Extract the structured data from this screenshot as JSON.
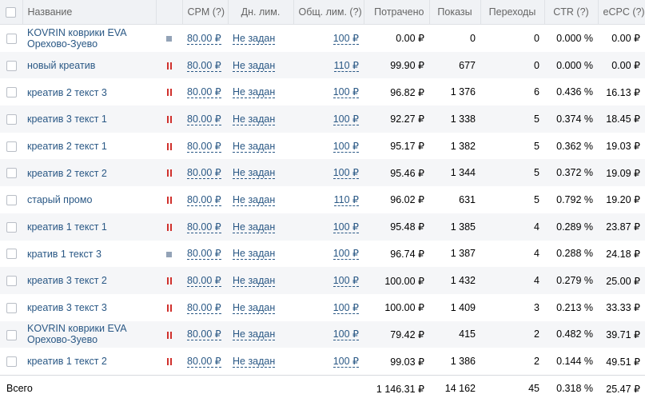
{
  "header": {
    "name": "Название",
    "cpm": "CPM (?)",
    "daily_limit": "Дн. лим.",
    "total_limit": "Общ. лим. (?)",
    "spent": "Потрачено",
    "shows": "Показы",
    "transitions": "Переходы",
    "ctr": "CTR (?)",
    "ecpc": "eCPC (?)"
  },
  "rows": [
    {
      "name": "KOVRIN коврики EVA Орехово-Зуево",
      "status": "stopped",
      "cpm": "80.00 ₽",
      "daily_limit": "Не задан",
      "total_limit": "100 ₽",
      "spent": "0.00 ₽",
      "shows": "0",
      "transitions": "0",
      "ctr": "0.000 %",
      "ecpc": "0.00 ₽"
    },
    {
      "name": "новый креатив",
      "status": "paused",
      "cpm": "80.00 ₽",
      "daily_limit": "Не задан",
      "total_limit": "110 ₽",
      "spent": "99.90 ₽",
      "shows": "677",
      "transitions": "0",
      "ctr": "0.000 %",
      "ecpc": "0.00 ₽"
    },
    {
      "name": "креатив 2 текст 3",
      "status": "paused",
      "cpm": "80.00 ₽",
      "daily_limit": "Не задан",
      "total_limit": "100 ₽",
      "spent": "96.82 ₽",
      "shows": "1 376",
      "transitions": "6",
      "ctr": "0.436 %",
      "ecpc": "16.13 ₽"
    },
    {
      "name": "креатив 3 текст 1",
      "status": "paused",
      "cpm": "80.00 ₽",
      "daily_limit": "Не задан",
      "total_limit": "100 ₽",
      "spent": "92.27 ₽",
      "shows": "1 338",
      "transitions": "5",
      "ctr": "0.374 %",
      "ecpc": "18.45 ₽"
    },
    {
      "name": "креатив 2 текст 1",
      "status": "paused",
      "cpm": "80.00 ₽",
      "daily_limit": "Не задан",
      "total_limit": "100 ₽",
      "spent": "95.17 ₽",
      "shows": "1 382",
      "transitions": "5",
      "ctr": "0.362 %",
      "ecpc": "19.03 ₽"
    },
    {
      "name": "креатив 2 текст 2",
      "status": "paused",
      "cpm": "80.00 ₽",
      "daily_limit": "Не задан",
      "total_limit": "100 ₽",
      "spent": "95.46 ₽",
      "shows": "1 344",
      "transitions": "5",
      "ctr": "0.372 %",
      "ecpc": "19.09 ₽"
    },
    {
      "name": "старый промо",
      "status": "paused",
      "cpm": "80.00 ₽",
      "daily_limit": "Не задан",
      "total_limit": "110 ₽",
      "spent": "96.02 ₽",
      "shows": "631",
      "transitions": "5",
      "ctr": "0.792 %",
      "ecpc": "19.20 ₽"
    },
    {
      "name": "креатив 1 текст 1",
      "status": "paused",
      "cpm": "80.00 ₽",
      "daily_limit": "Не задан",
      "total_limit": "100 ₽",
      "spent": "95.48 ₽",
      "shows": "1 385",
      "transitions": "4",
      "ctr": "0.289 %",
      "ecpc": "23.87 ₽"
    },
    {
      "name": "кратив 1 текст 3",
      "status": "stopped",
      "cpm": "80.00 ₽",
      "daily_limit": "Не задан",
      "total_limit": "100 ₽",
      "spent": "96.74 ₽",
      "shows": "1 387",
      "transitions": "4",
      "ctr": "0.288 %",
      "ecpc": "24.18 ₽"
    },
    {
      "name": "креатив 3 текст 2",
      "status": "paused",
      "cpm": "80.00 ₽",
      "daily_limit": "Не задан",
      "total_limit": "100 ₽",
      "spent": "100.00 ₽",
      "shows": "1 432",
      "transitions": "4",
      "ctr": "0.279 %",
      "ecpc": "25.00 ₽"
    },
    {
      "name": "креатив 3 текст 3",
      "status": "paused",
      "cpm": "80.00 ₽",
      "daily_limit": "Не задан",
      "total_limit": "100 ₽",
      "spent": "100.00 ₽",
      "shows": "1 409",
      "transitions": "3",
      "ctr": "0.213 %",
      "ecpc": "33.33 ₽"
    },
    {
      "name": "KOVRIN коврики EVA Орехово-Зуево",
      "status": "paused",
      "cpm": "80.00 ₽",
      "daily_limit": "Не задан",
      "total_limit": "100 ₽",
      "spent": "79.42 ₽",
      "shows": "415",
      "transitions": "2",
      "ctr": "0.482 %",
      "ecpc": "39.71 ₽"
    },
    {
      "name": "креатив 1 текст 2",
      "status": "paused",
      "cpm": "80.00 ₽",
      "daily_limit": "Не задан",
      "total_limit": "100 ₽",
      "spent": "99.03 ₽",
      "shows": "1 386",
      "transitions": "2",
      "ctr": "0.144 %",
      "ecpc": "49.51 ₽"
    }
  ],
  "totals": {
    "label": "Всего",
    "spent": "1 146.31 ₽",
    "shows": "14 162",
    "transitions": "45",
    "ctr": "0.318 %",
    "ecpc": "25.47 ₽"
  },
  "icons": {
    "stopped": "stop-square-icon",
    "paused": "pause-icon"
  },
  "colors": {
    "link": "#2a5885",
    "paused": "#d0312d",
    "stopped": "#93a3b7",
    "header_bg": "#f0f2f5"
  }
}
